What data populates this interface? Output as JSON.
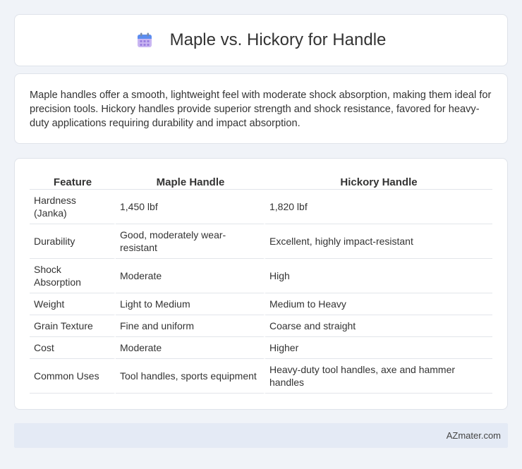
{
  "header": {
    "title": "Maple vs. Hickory for Handle",
    "icon": "calendar-icon"
  },
  "summary": {
    "text": "Maple handles offer a smooth, lightweight feel with moderate shock absorption, making them ideal for precision tools. Hickory handles provide superior strength and shock resistance, favored for heavy-duty applications requiring durability and impact absorption."
  },
  "table": {
    "headers": [
      "Feature",
      "Maple Handle",
      "Hickory Handle"
    ],
    "rows": [
      [
        "Hardness (Janka)",
        "1,450 lbf",
        "1,820 lbf"
      ],
      [
        "Durability",
        "Good, moderately wear-resistant",
        "Excellent, highly impact-resistant"
      ],
      [
        "Shock Absorption",
        "Moderate",
        "High"
      ],
      [
        "Weight",
        "Light to Medium",
        "Medium to Heavy"
      ],
      [
        "Grain Texture",
        "Fine and uniform",
        "Coarse and straight"
      ],
      [
        "Cost",
        "Moderate",
        "Higher"
      ],
      [
        "Common Uses",
        "Tool handles, sports equipment",
        "Heavy-duty tool handles, axe and hammer handles"
      ]
    ]
  },
  "footer": {
    "brand": "AZmater.com"
  }
}
